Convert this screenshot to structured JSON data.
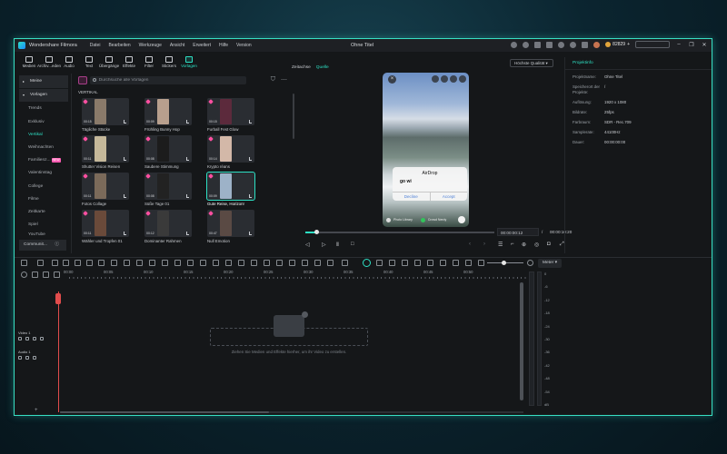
{
  "titlebar": {
    "app_name": "Wondershare Filmora",
    "menu": [
      "Datei",
      "Bearbeiten",
      "Werkzeuge",
      "Ansicht",
      "Erweitert",
      "Hilfe",
      "Version"
    ],
    "project_title": "Ohne Titel",
    "credits": "82829",
    "window_buttons": [
      "–",
      "❐",
      "✕"
    ]
  },
  "toolbar": {
    "items": [
      {
        "label": "Medien",
        "icon": "media-icon"
      },
      {
        "label": "Archiv...eden",
        "icon": "archive-icon"
      },
      {
        "label": "Audio",
        "icon": "audio-icon"
      },
      {
        "label": "Text",
        "icon": "text-icon"
      },
      {
        "label": "Übergänge",
        "icon": "transitions-icon"
      },
      {
        "label": "Effekte",
        "icon": "effects-icon"
      },
      {
        "label": "Filter",
        "icon": "filter-icon"
      },
      {
        "label": "Stickers",
        "icon": "stickers-icon"
      },
      {
        "label": "Vorlagen",
        "icon": "templates-icon",
        "active": true
      }
    ]
  },
  "sidebar": {
    "items": [
      {
        "label": "Meine",
        "type": "group"
      },
      {
        "label": "Vorlagen",
        "type": "group-open"
      },
      {
        "label": "Trends"
      },
      {
        "label": "Exklusiv"
      },
      {
        "label": "Vertikal",
        "selected": true
      },
      {
        "label": "Weihnachten"
      },
      {
        "label": "Familienz...",
        "badge": "NEW"
      },
      {
        "label": "Valentinstag"
      },
      {
        "label": "College"
      },
      {
        "label": "Filme"
      },
      {
        "label": "Zeitkarte"
      },
      {
        "label": "Spiel"
      },
      {
        "label": "YouTube"
      }
    ],
    "footer": "Communit..."
  },
  "browser": {
    "search_placeholder": "Durchsuche alle Vorlagen",
    "section": "VERTIKAL",
    "cards": [
      {
        "title": "Tägliche Stücke",
        "duration": "00:15",
        "color": "#8a7a6a"
      },
      {
        "title": "Frühling Bunny Hop",
        "duration": "00:09",
        "color": "#b89f8d"
      },
      {
        "title": "Furball Fest Glow",
        "duration": "00:15",
        "color": "#5c2a3c"
      },
      {
        "title": "Shutter Vision Reisen",
        "duration": "00:11",
        "color": "#c5b89a"
      },
      {
        "title": "Saubere Stimmung",
        "duration": "00:08",
        "color": "#1c1c1c"
      },
      {
        "title": "Krypto réans",
        "duration": "00:14",
        "color": "#d3b8a8"
      },
      {
        "title": "Fotos Collage",
        "duration": "00:11",
        "color": "#7b6a5a"
      },
      {
        "title": "Süße Tage 01",
        "duration": "00:08",
        "color": "#222222"
      },
      {
        "title": "Gute Reise, Horizon!",
        "duration": "00:09",
        "color": "#9db2c8",
        "selected": true
      },
      {
        "title": "Wähler und Tropfen 01",
        "duration": "00:11",
        "color": "#6a4a3a"
      },
      {
        "title": "Dominanter Rahmen",
        "duration": "00:12",
        "color": "#3a3a3a"
      },
      {
        "title": "Null Emotion",
        "duration": "00:47",
        "color": "#5a4a44"
      }
    ]
  },
  "preview": {
    "tabs": [
      "Zeitachse",
      "Quelle"
    ],
    "active_tab": "Quelle",
    "quality": "Höchste Qualität",
    "airdrop": {
      "title": "AirDrop",
      "message": "go wi",
      "decline": "Decline",
      "accept": "Accept"
    },
    "phone_bottom": {
      "left": "Photo Library",
      "middle": "Crowd Nerdy"
    },
    "timecode_current": "00:00:00:12",
    "timecode_sep": "/",
    "timecode_total": "00:00:10:20",
    "playback_progress_fraction": 0.06
  },
  "properties": {
    "tab": "Projektinfo",
    "rows": [
      {
        "key": "Projektname:",
        "value": "Ohne Titel"
      },
      {
        "key": "Speicherort der Projekte:",
        "value": "/"
      },
      {
        "key": "Auflösung:",
        "value": "1920 x 1080"
      },
      {
        "key": "Bildrate:",
        "value": "25fps"
      },
      {
        "key": "Farbraum:",
        "value": "SDR - Rec.709"
      },
      {
        "key": "Samplerate:",
        "value": "44100Hz"
      },
      {
        "key": "Dauer:",
        "value": "00:00:00:00"
      }
    ]
  },
  "timeline": {
    "meter_button": "Meter",
    "ruler_labels": [
      "00:00",
      "00:05",
      "00:10",
      "00:15",
      "00:20",
      "00:25",
      "00:30",
      "00:35",
      "00:40",
      "00:45",
      "00:50"
    ],
    "tracks": [
      {
        "label": "Video 1"
      },
      {
        "label": "Audio 1"
      }
    ],
    "drop_text": "Ziehen Sie Medien und Effekte hierher, um ihr Video zu erstellen.",
    "meter_scale": [
      "0",
      "-6",
      "-12",
      "-18",
      "-24",
      "-30",
      "-36",
      "-42",
      "-48",
      "-54",
      "dB"
    ],
    "add_track": "+"
  }
}
